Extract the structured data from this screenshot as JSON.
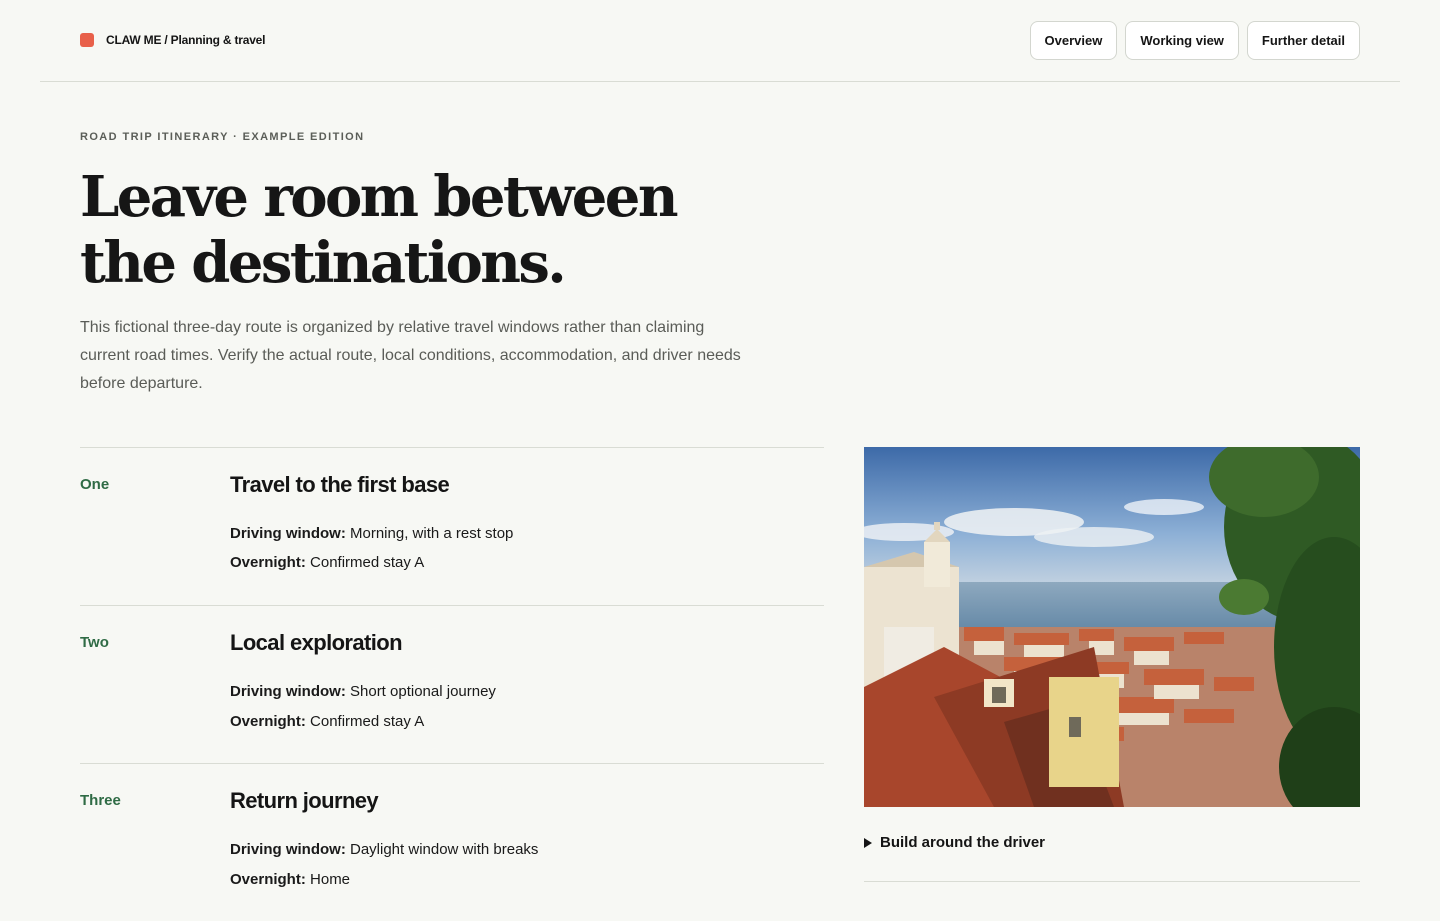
{
  "header": {
    "brand_text": "CLAW ME / Planning & travel",
    "brand_color": "#e8604a",
    "nav": [
      "Overview",
      "Working view",
      "Further detail"
    ]
  },
  "hero": {
    "eyebrow": "ROAD TRIP ITINERARY · EXAMPLE EDITION",
    "headline_line1": "Leave room between",
    "headline_line2": "the destinations.",
    "intro": "This fictional three-day route is organized by relative travel windows rather than claiming current road times. Verify the actual route, local conditions, accommodation, and driver needs before departure."
  },
  "days": [
    {
      "num": "One",
      "title": "Travel to the first base",
      "driving_label": "Driving window:",
      "driving": "Morning, with a rest stop",
      "overnight_label": "Overnight:",
      "overnight": "Confirmed stay A"
    },
    {
      "num": "Two",
      "title": "Local exploration",
      "driving_label": "Driving window:",
      "driving": "Short optional journey",
      "overnight_label": "Overnight:",
      "overnight": "Confirmed stay A"
    },
    {
      "num": "Three",
      "title": "Return journey",
      "driving_label": "Driving window:",
      "driving": "Daylight window with breaks",
      "overnight_label": "Overnight:",
      "overnight": "Home"
    }
  ],
  "aside": {
    "details_label": "Build around the driver"
  },
  "colors": {
    "accent_green": "#2f6b45",
    "background": "#f7f8f4"
  }
}
